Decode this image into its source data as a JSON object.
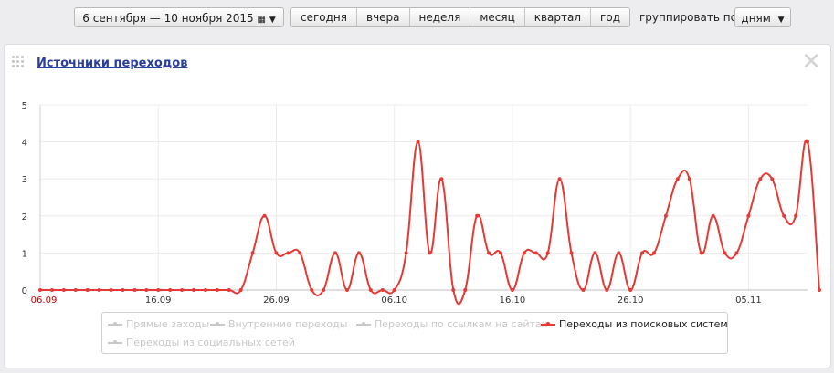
{
  "toolbar": {
    "date_range": "6 сентября — 10 ноября 2015",
    "periods": [
      "сегодня",
      "вчера",
      "неделя",
      "месяц",
      "квартал",
      "год"
    ],
    "group_label": "группировать по",
    "group_value": "дням"
  },
  "panel": {
    "title": "Источники переходов"
  },
  "colors": {
    "active": "#e53935",
    "inactive": "#c8c8c8"
  },
  "chart_data": {
    "type": "line",
    "x_start": "2015-09-06",
    "x_end": "2015-11-10",
    "xticks": [
      "06.09",
      "16.09",
      "26.09",
      "06.10",
      "16.10",
      "26.10",
      "05.11"
    ],
    "yticks": [
      "0",
      "1",
      "2",
      "3",
      "4",
      "5"
    ],
    "ylim": [
      0,
      5
    ],
    "grid": true,
    "legend_position": "bottom",
    "series": [
      {
        "name": "Прямые заходы",
        "visible": false,
        "values": []
      },
      {
        "name": "Внутренние переходы",
        "visible": false,
        "values": []
      },
      {
        "name": "Переходы по ссылкам на сайтах",
        "visible": false,
        "values": []
      },
      {
        "name": "Переходы из поисковых систем",
        "visible": true,
        "values": [
          0,
          0,
          0,
          0,
          0,
          0,
          0,
          0,
          0,
          0,
          0,
          0,
          0,
          0,
          0,
          0,
          0,
          0,
          1,
          2,
          1,
          1,
          1,
          0,
          0,
          1,
          0,
          1,
          0,
          0,
          0,
          1,
          4,
          1,
          3,
          0,
          0,
          2,
          1,
          1,
          0,
          1,
          1,
          1,
          3,
          1,
          0,
          1,
          0,
          1,
          0,
          1,
          1,
          2,
          3,
          3,
          1,
          2,
          1,
          1,
          2,
          3,
          3,
          2,
          2,
          4,
          0
        ]
      },
      {
        "name": "Переходы из социальных сетей",
        "visible": false,
        "values": []
      }
    ]
  }
}
